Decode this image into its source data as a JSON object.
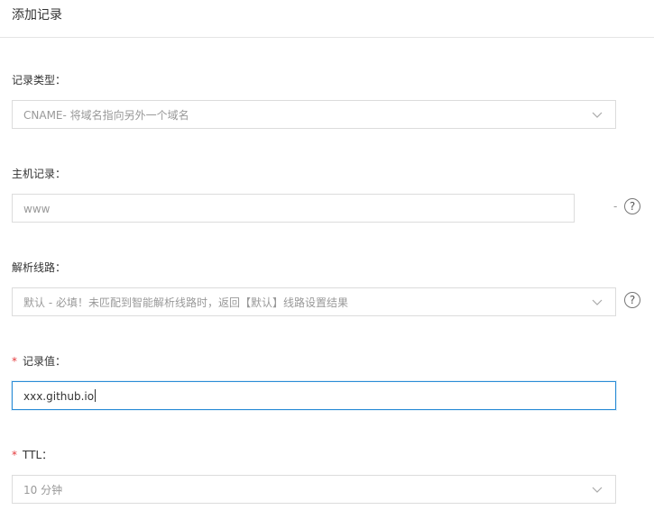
{
  "header": {
    "title": "添加记录"
  },
  "record_type": {
    "label": "记录类型：",
    "value": "CNAME- 将域名指向另外一个域名",
    "icon": "chevron-down-icon"
  },
  "host": {
    "label": "主机记录：",
    "value": "www",
    "suffix": "-",
    "help_icon": "question-circle-icon",
    "help_glyph": "?"
  },
  "line": {
    "label": "解析线路：",
    "value": "默认 - 必填！未匹配到智能解析线路时，返回【默认】线路设置结果",
    "icon": "chevron-down-icon",
    "help_icon": "question-circle-icon",
    "help_glyph": "?"
  },
  "record_value": {
    "required_mark": "*",
    "label": "记录值：",
    "value": "xxx.github.io"
  },
  "ttl": {
    "required_mark": "*",
    "label": "TTL：",
    "value": "10 分钟",
    "icon": "chevron-down-icon"
  },
  "colors": {
    "focus_border": "#2a8cd6",
    "required": "#e4393c",
    "border": "#dcdcdc"
  }
}
